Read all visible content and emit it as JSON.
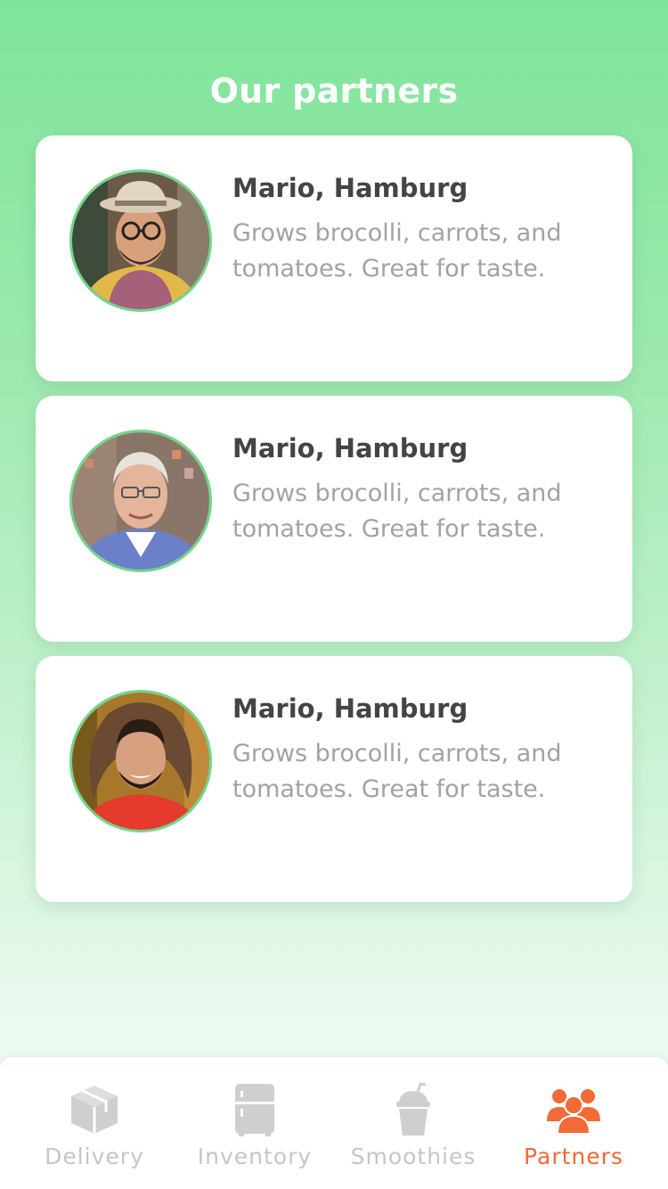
{
  "header": {
    "title": "Our partners"
  },
  "partners": [
    {
      "name": "Mario, Hamburg",
      "description": "Grows brocolli, carrots, and tomatoes. Great for taste."
    },
    {
      "name": "Mario, Hamburg",
      "description": "Grows brocolli, carrots, and tomatoes. Great for taste."
    },
    {
      "name": "Mario, Hamburg",
      "description": "Grows brocolli, carrots, and tomatoes. Great for taste."
    }
  ],
  "tabs": [
    {
      "label": "Delivery",
      "icon": "box-icon",
      "active": false
    },
    {
      "label": "Inventory",
      "icon": "fridge-icon",
      "active": false
    },
    {
      "label": "Smoothies",
      "icon": "smoothie-cup-icon",
      "active": false
    },
    {
      "label": "Partners",
      "icon": "people-icon",
      "active": true
    }
  ],
  "colors": {
    "accent": "#f26a35",
    "background_top": "#7fe49a",
    "avatar_ring": "#6fd68a",
    "inactive": "#c6c6c6"
  }
}
